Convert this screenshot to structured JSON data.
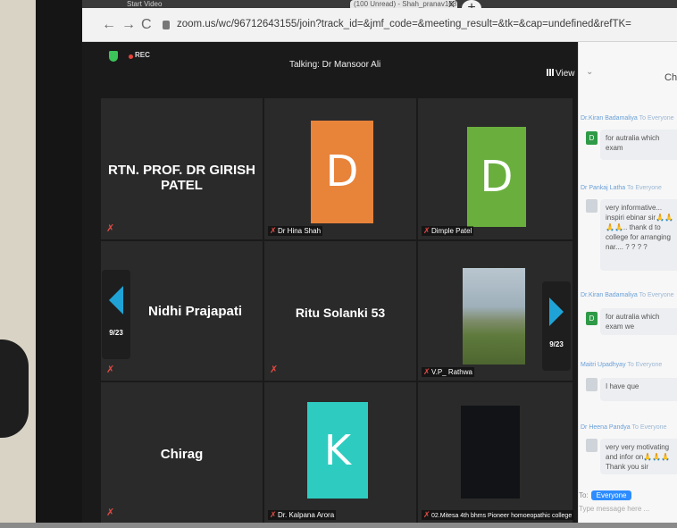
{
  "browser": {
    "tabs": [
      "Start Video",
      "(100 Unread) - Shah_pranav168...",
      "X"
    ],
    "new_tab": "+",
    "back": "←",
    "forward": "→",
    "reload": "C",
    "url": "zoom.us/wc/96712643155/join?track_id=&jmf_code=&meeting_result=&tk=&cap=undefined&refTK="
  },
  "meeting": {
    "rec_label": "REC",
    "talking": "Talking: Dr Mansoor Ali",
    "view_label": "View",
    "page_left": "9/23",
    "page_right": "9/23",
    "tiles": {
      "girish": {
        "name": "RTN. PROF. DR GIRISH PATEL"
      },
      "hina": {
        "letter": "D",
        "label": "Dr Hina Shah",
        "color": "#e8833a"
      },
      "dimple": {
        "letter": "D",
        "label": "Dimple Patel",
        "color": "#6aaf3e"
      },
      "nidhi": {
        "name": "Nidhi Prajapati"
      },
      "ritu": {
        "name": "Ritu Solanki 53"
      },
      "rathwa": {
        "label": "V.P_ Rathwa"
      },
      "chirag": {
        "name": "Chirag"
      },
      "kalpana": {
        "letter": "K",
        "label": "Dr. Kalpana Arora",
        "color": "#2ecbc0"
      },
      "mitesa": {
        "label": "02.Mitesa 4th bhms Pioneer homoeopathic college"
      }
    }
  },
  "chat": {
    "title": "Ch",
    "messages": [
      {
        "from": "Dr.Kiran Badamaliya",
        "to": "To Everyone",
        "avatar": "D",
        "text": "for autralia which exam"
      },
      {
        "from": "Dr Pankaj Latha",
        "to": "To Everyone",
        "avatar": "",
        "text": "very informative... inspiri ebinar sir🙏🙏🙏🙏.. thank d to college for arranging nar.... ? ? ? ?"
      },
      {
        "from": "Dr.Kiran Badamaliya",
        "to": "To Everyone",
        "avatar": "D",
        "text": "for autralia which exam we"
      },
      {
        "from": "Maitri Upadhyay",
        "to": "To Everyone",
        "avatar": "",
        "text": "I have que"
      },
      {
        "from": "Dr Heena Pandya",
        "to": "To Everyone",
        "avatar": "",
        "text": "very very motivating and infor on🙏🙏🙏 Thank you sir"
      }
    ],
    "to_label": "To:",
    "to_value": "Everyone",
    "input_placeholder": "Type message here ..."
  }
}
